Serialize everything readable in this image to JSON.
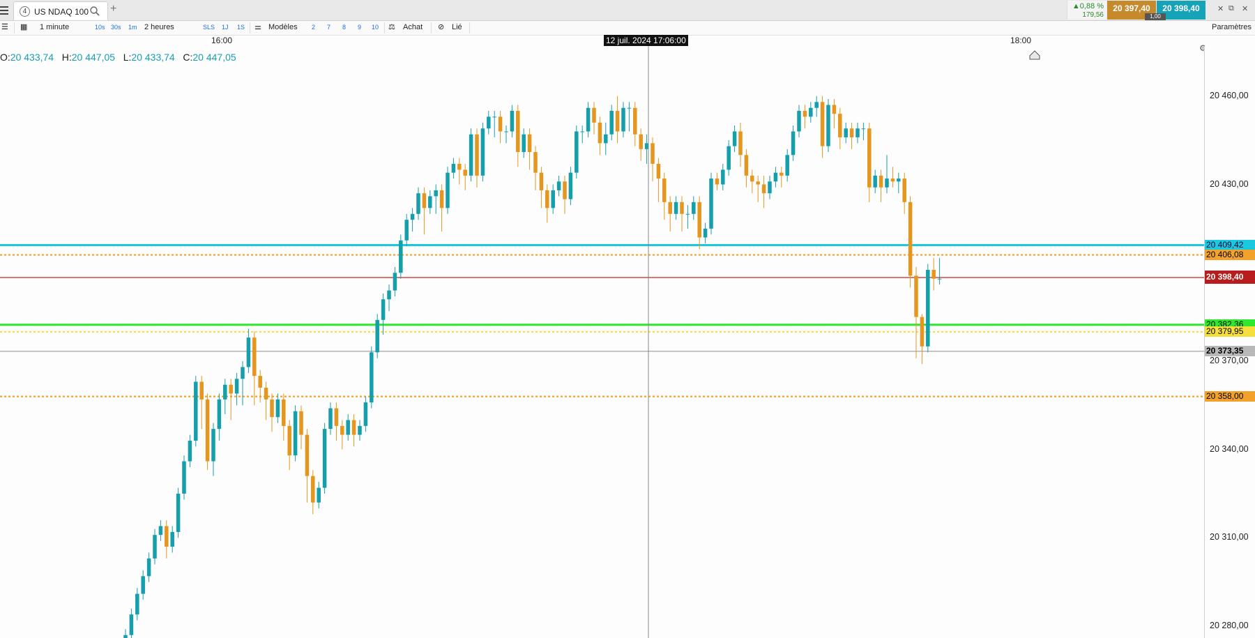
{
  "tab": {
    "number": "4",
    "title": "US NDAQ 100"
  },
  "quote": {
    "change_pct": "▲0,88 %",
    "change_abs": "179,56",
    "sell": "20 397,40",
    "buy": "20 398,40",
    "spread": "1,00"
  },
  "toolbar": {
    "interval": "1 minute",
    "quick_intervals": [
      "10s",
      "30s",
      "1m"
    ],
    "period": "2 heures",
    "quick_modes": [
      "SLS",
      "1J",
      "1S"
    ],
    "templates_label": "Modèles",
    "template_slots": [
      "2",
      "7",
      "8",
      "9",
      "10"
    ],
    "buy_label": "Achat",
    "link_label": "Lié",
    "settings_label": "Paramètres"
  },
  "time_axis": {
    "labels": [
      "16:00",
      "18:00"
    ],
    "crosshair_time": "12 juil. 2024 17:06:00"
  },
  "ohlc": {
    "o_label": "O:",
    "o": "20 433,74",
    "h_label": "H:",
    "h": "20 447,05",
    "l_label": "L:",
    "l": "20 433,74",
    "c_label": "C:",
    "c": "20 447,05"
  },
  "price_axis": {
    "labels": [
      "20 460,00",
      "20 430,00",
      "20 370,00",
      "20 340,00",
      "20 310,00",
      "20 280,00"
    ]
  },
  "price_tags": [
    {
      "text": "20 409,42",
      "bg": "#19c9e0",
      "color": "#003"
    },
    {
      "text": "20 406,08",
      "bg": "#f2a22a",
      "color": "#000"
    },
    {
      "text": "20 398,40",
      "bg": "#b81c1c",
      "color": "#fff"
    },
    {
      "text": "20 382,36",
      "bg": "#2ee82e",
      "color": "#000"
    },
    {
      "text": "20 379,95",
      "bg": "#f5df3c",
      "color": "#000"
    },
    {
      "text": "20 373,35",
      "bg": "#b8b8b8",
      "color": "#000"
    },
    {
      "text": "20 358,00",
      "bg": "#f2a22a",
      "color": "#000"
    }
  ],
  "colors": {
    "up": "#149fab",
    "down": "#e4961e"
  },
  "chart_data": {
    "type": "candlestick",
    "ylim": [
      20276,
      20477
    ],
    "levels": [
      {
        "value": 20409.42,
        "color": "#19c9e0",
        "style": "solid"
      },
      {
        "value": 20406.08,
        "color": "#f2a22a",
        "style": "dotted"
      },
      {
        "value": 20398.4,
        "color": "#d02020",
        "style": "solid"
      },
      {
        "value": 20382.36,
        "color": "#2ee82e",
        "style": "solid"
      },
      {
        "value": 20379.95,
        "color": "#f5df3c",
        "style": "dotted"
      },
      {
        "value": 20373.35,
        "color": "#999999",
        "style": "solid"
      },
      {
        "value": 20358.0,
        "color": "#f2a22a",
        "style": "dotted"
      }
    ],
    "candles": [
      [
        20270,
        20277,
        20267,
        20279
      ],
      [
        20277,
        20284,
        20275,
        20286
      ],
      [
        20284,
        20291,
        20282,
        20293
      ],
      [
        20291,
        20297,
        20289,
        20299
      ],
      [
        20297,
        20303,
        20295,
        20305
      ],
      [
        20303,
        20311,
        20301,
        20313
      ],
      [
        20311,
        20314,
        20309,
        20316
      ],
      [
        20314,
        20307,
        20303,
        20316
      ],
      [
        20307,
        20312,
        20305,
        20314
      ],
      [
        20312,
        20325,
        20310,
        20327
      ],
      [
        20325,
        20336,
        20323,
        20338
      ],
      [
        20336,
        20343,
        20334,
        20345
      ],
      [
        20343,
        20363,
        20341,
        20365
      ],
      [
        20363,
        20357,
        20347,
        20365
      ],
      [
        20357,
        20336,
        20333,
        20359
      ],
      [
        20336,
        20347,
        20331,
        20349
      ],
      [
        20347,
        20357,
        20343,
        20359
      ],
      [
        20357,
        20362,
        20352,
        20364
      ],
      [
        20362,
        20359,
        20350,
        20364
      ],
      [
        20359,
        20364,
        20355,
        20366
      ],
      [
        20364,
        20368,
        20355,
        20370
      ],
      [
        20368,
        20378,
        20366,
        20381
      ],
      [
        20378,
        20365,
        20355,
        20380
      ],
      [
        20365,
        20361,
        20356,
        20367
      ],
      [
        20361,
        20357,
        20350,
        20363
      ],
      [
        20357,
        20351,
        20346,
        20359
      ],
      [
        20351,
        20357,
        20349,
        20359
      ],
      [
        20357,
        20348,
        20343,
        20359
      ],
      [
        20348,
        20338,
        20333,
        20350
      ],
      [
        20338,
        20353,
        20336,
        20355
      ],
      [
        20353,
        20345,
        20340,
        20355
      ],
      [
        20345,
        20331,
        20322,
        20347
      ],
      [
        20331,
        20322,
        20318,
        20333
      ],
      [
        20322,
        20327,
        20320,
        20329
      ],
      [
        20327,
        20347,
        20325,
        20349
      ],
      [
        20347,
        20354,
        20345,
        20356
      ],
      [
        20354,
        20348,
        20343,
        20356
      ],
      [
        20348,
        20345,
        20340,
        20350
      ],
      [
        20345,
        20350,
        20343,
        20352
      ],
      [
        20350,
        20345,
        20341,
        20352
      ],
      [
        20345,
        20348,
        20343,
        20350
      ],
      [
        20348,
        20356,
        20346,
        20358
      ],
      [
        20356,
        20373,
        20354,
        20375
      ],
      [
        20373,
        20384,
        20371,
        20386
      ],
      [
        20384,
        20391,
        20379,
        20393
      ],
      [
        20391,
        20394,
        20387,
        20396
      ],
      [
        20394,
        20400,
        20392,
        20402
      ],
      [
        20400,
        20411,
        20398,
        20413
      ],
      [
        20411,
        20418,
        20409,
        20420
      ],
      [
        20418,
        20420,
        20414,
        20422
      ],
      [
        20420,
        20427,
        20418,
        20429
      ],
      [
        20427,
        20422,
        20413,
        20429
      ],
      [
        20422,
        20426,
        20420,
        20428
      ],
      [
        20426,
        20428,
        20420,
        20430
      ],
      [
        20428,
        20422,
        20414,
        20430
      ],
      [
        20422,
        20434,
        20420,
        20436
      ],
      [
        20434,
        20437,
        20432,
        20439
      ],
      [
        20437,
        20435,
        20430,
        20439
      ],
      [
        20435,
        20433,
        20428,
        20437
      ],
      [
        20433,
        20447,
        20431,
        20449
      ],
      [
        20447,
        20433,
        20429,
        20449
      ],
      [
        20433,
        20449,
        20431,
        20451
      ],
      [
        20449,
        20453,
        20447,
        20455
      ],
      [
        20453,
        20453,
        20446,
        20455
      ],
      [
        20453,
        20448,
        20444,
        20455
      ],
      [
        20448,
        20448,
        20444,
        20450
      ],
      [
        20448,
        20455,
        20446,
        20457
      ],
      [
        20455,
        20441,
        20436,
        20457
      ],
      [
        20441,
        20447,
        20439,
        20449
      ],
      [
        20447,
        20441,
        20435,
        20449
      ],
      [
        20441,
        20434,
        20428,
        20443
      ],
      [
        20434,
        20428,
        20422,
        20436
      ],
      [
        20428,
        20422,
        20417,
        20430
      ],
      [
        20422,
        20428,
        20420,
        20430
      ],
      [
        20428,
        20431,
        20426,
        20433
      ],
      [
        20431,
        20425,
        20420,
        20433
      ],
      [
        20425,
        20434,
        20423,
        20436
      ],
      [
        20434,
        20448,
        20432,
        20450
      ],
      [
        20448,
        20448,
        20444,
        20450
      ],
      [
        20448,
        20456,
        20446,
        20458
      ],
      [
        20456,
        20451,
        20447,
        20458
      ],
      [
        20451,
        20444,
        20440,
        20453
      ],
      [
        20444,
        20447,
        20440,
        20451
      ],
      [
        20447,
        20455,
        20445,
        20457
      ],
      [
        20455,
        20448,
        20444,
        20460
      ],
      [
        20448,
        20456,
        20446,
        20458
      ],
      [
        20456,
        20456,
        20448,
        20458
      ],
      [
        20456,
        20447,
        20443,
        20458
      ],
      [
        20447,
        20442,
        20438,
        20449
      ],
      [
        20442,
        20444,
        20437,
        20447
      ],
      [
        20444,
        20437,
        20431,
        20446
      ],
      [
        20437,
        20432,
        20424,
        20439
      ],
      [
        20432,
        20424,
        20418,
        20434
      ],
      [
        20424,
        20420,
        20414,
        20426
      ],
      [
        20420,
        20424,
        20418,
        20426
      ],
      [
        20424,
        20420,
        20414,
        20426
      ],
      [
        20420,
        20420,
        20415,
        20423
      ],
      [
        20420,
        20424,
        20418,
        20426
      ],
      [
        20424,
        20412,
        20408,
        20426
      ],
      [
        20412,
        20415,
        20410,
        20417
      ],
      [
        20415,
        20432,
        20413,
        20434
      ],
      [
        20432,
        20430,
        20428,
        20434
      ],
      [
        20430,
        20435,
        20428,
        20437
      ],
      [
        20435,
        20443,
        20433,
        20445
      ],
      [
        20443,
        20448,
        20441,
        20450
      ],
      [
        20448,
        20440,
        20436,
        20451
      ],
      [
        20440,
        20433,
        20429,
        20442
      ],
      [
        20433,
        20431,
        20427,
        20435
      ],
      [
        20431,
        20430,
        20424,
        20433
      ],
      [
        20430,
        20427,
        20422,
        20433
      ],
      [
        20427,
        20431,
        20425,
        20433
      ],
      [
        20431,
        20434,
        20429,
        20436
      ],
      [
        20434,
        20433,
        20429,
        20436
      ],
      [
        20433,
        20440,
        20431,
        20442
      ],
      [
        20440,
        20448,
        20438,
        20450
      ],
      [
        20448,
        20455,
        20446,
        20457
      ],
      [
        20455,
        20453,
        20449,
        20457
      ],
      [
        20453,
        20456,
        20451,
        20458
      ],
      [
        20456,
        20458,
        20453,
        20460
      ],
      [
        20458,
        20443,
        20439,
        20460
      ],
      [
        20443,
        20457,
        20441,
        20459
      ],
      [
        20457,
        20454,
        20449,
        20459
      ],
      [
        20454,
        20446,
        20442,
        20456
      ],
      [
        20446,
        20449,
        20444,
        20451
      ],
      [
        20449,
        20446,
        20442,
        20451
      ],
      [
        20446,
        20449,
        20444,
        20451
      ],
      [
        20449,
        20449,
        20445,
        20451
      ],
      [
        20449,
        20429,
        20424,
        20451
      ],
      [
        20429,
        20433,
        20427,
        20435
      ],
      [
        20433,
        20429,
        20424,
        20435
      ],
      [
        20429,
        20432,
        20427,
        20440
      ],
      [
        20432,
        20431,
        20429,
        20436
      ],
      [
        20431,
        20432,
        20427,
        20434
      ],
      [
        20432,
        20424,
        20420,
        20434
      ],
      [
        20424,
        20399,
        20395,
        20426
      ],
      [
        20399,
        20385,
        20371,
        20402
      ],
      [
        20385,
        20375,
        20369,
        20386
      ],
      [
        20375,
        20401,
        20373,
        20403
      ],
      [
        20401,
        20398,
        20394,
        20405
      ],
      [
        20398,
        20398,
        20396,
        20405
      ]
    ]
  }
}
